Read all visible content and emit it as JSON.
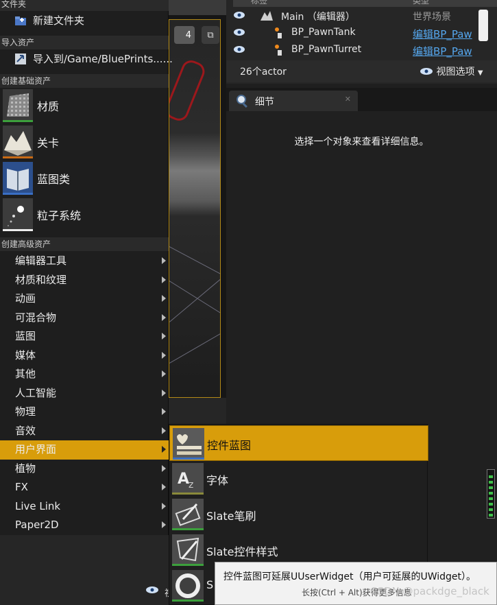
{
  "outliner": {
    "col_label": "标签",
    "col_type": "类型",
    "rows": [
      {
        "name": "Main （编辑器）",
        "type": "世界场景"
      },
      {
        "name": "BP_PawnTank",
        "type": "编辑BP_Paw"
      },
      {
        "name": "BP_PawnTurret",
        "type": "编辑BP_Paw"
      }
    ],
    "actor_count": "26个actor",
    "view_options": "视图选项"
  },
  "viewport": {
    "badge": "4"
  },
  "details": {
    "tab_label": "细节",
    "empty_message": "选择一个对象来查看详细信息。"
  },
  "menu": {
    "folder_section": "文件夹",
    "new_folder": "新建文件夹",
    "import_section": "导入资产",
    "import_to": "导入到/Game/BluePrints......",
    "basic_section": "创建基础资产",
    "basic_assets": [
      {
        "label": "材质"
      },
      {
        "label": "关卡"
      },
      {
        "label": "蓝图类"
      },
      {
        "label": "粒子系统"
      }
    ],
    "advanced_section": "创建高级资产",
    "advanced_items": [
      {
        "label": "编辑器工具"
      },
      {
        "label": "材质和纹理"
      },
      {
        "label": "动画"
      },
      {
        "label": "可混合物"
      },
      {
        "label": "蓝图"
      },
      {
        "label": "媒体"
      },
      {
        "label": "其他"
      },
      {
        "label": "人工智能"
      },
      {
        "label": "物理"
      },
      {
        "label": "音效"
      },
      {
        "label": "用户界面"
      },
      {
        "label": "植物"
      },
      {
        "label": "FX"
      },
      {
        "label": "Live Link"
      },
      {
        "label": "Paper2D"
      }
    ],
    "active_index": 10,
    "bottom_char": "视"
  },
  "submenu": {
    "items": [
      {
        "label": "控件蓝图"
      },
      {
        "label": "字体"
      },
      {
        "label": "Slate笔刷"
      },
      {
        "label": "Slate控件样式"
      },
      {
        "label": "S"
      }
    ]
  },
  "tooltip": {
    "line1": "控件蓝图可延展UUserWidget（用户可延展的UWidget）。",
    "line2": "长按(Ctrl + Alt)获得更多信息"
  },
  "watermark": "CSDN @packdge_black",
  "colors": {
    "accent": "#d89d0b",
    "menu_bg": "#1e1e1e",
    "link": "#55a7ee",
    "asset_bar_green": "#3ca03c",
    "asset_bar_blue": "#3a6fc4",
    "asset_bar_orange": "#c86a14"
  }
}
